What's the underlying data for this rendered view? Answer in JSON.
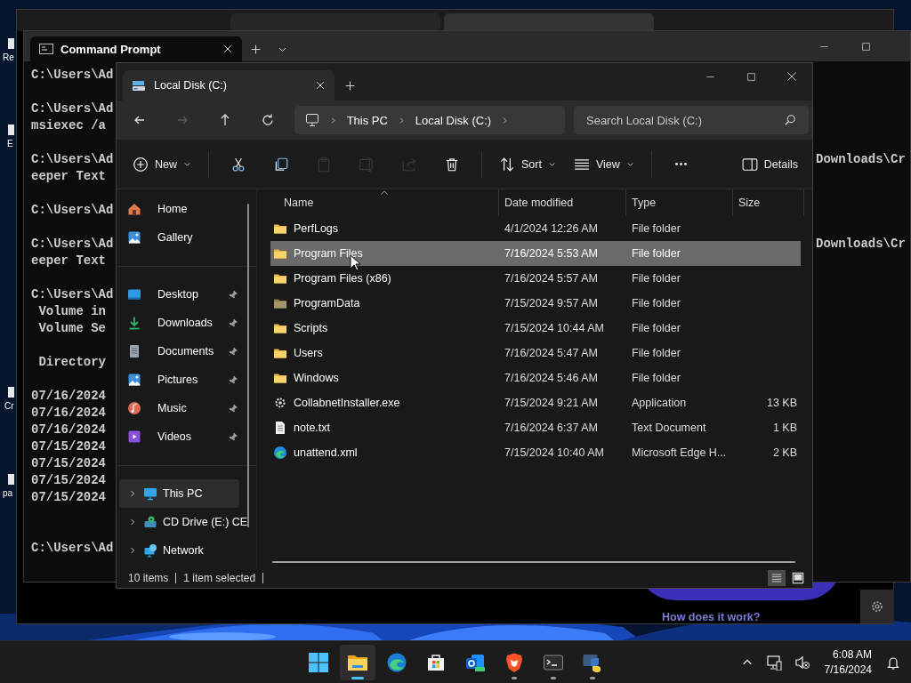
{
  "desktop_icons": [
    {
      "label": "Re"
    },
    {
      "label": "E"
    },
    {
      "label": "Cr"
    },
    {
      "label": "pa"
    }
  ],
  "browser": {
    "link": "How does it work?"
  },
  "cmd": {
    "tab_title": "Command Prompt",
    "blocks": [
      {
        "lines": [
          {
            "text": "C:\\Users\\Ad"
          }
        ]
      },
      {
        "lines": [
          {
            "text": "C:\\Users\\Ad"
          },
          {
            "text": "msiexec /a"
          }
        ]
      },
      {
        "lines": [
          {
            "text": "C:\\Users\\Ad",
            "right": "Downloads\\Cr"
          },
          {
            "text": "eeper Text"
          }
        ]
      },
      {
        "lines": [
          {
            "text": "C:\\Users\\Ad"
          }
        ]
      },
      {
        "lines": [
          {
            "text": "C:\\Users\\Ad",
            "right": "Downloads\\Cr"
          },
          {
            "text": "eeper Text"
          }
        ]
      },
      {
        "lines": [
          {
            "text": "C:\\Users\\Ad"
          },
          {
            "text": " Volume in"
          },
          {
            "text": " Volume Se"
          }
        ]
      },
      {
        "lines": [
          {
            "text": " Directory"
          }
        ]
      },
      {
        "lines": [
          {
            "text": "07/16/2024"
          },
          {
            "text": "07/16/2024"
          },
          {
            "text": "07/16/2024"
          },
          {
            "text": "07/15/2024"
          },
          {
            "text": "07/15/2024"
          },
          {
            "text": "07/15/2024"
          },
          {
            "text": "07/15/2024"
          }
        ]
      },
      {
        "lines": [
          {
            "text": "C:\\Users\\Ad"
          }
        ]
      }
    ]
  },
  "explorer": {
    "tab_title": "Local Disk (C:)",
    "nav": [
      {
        "kind": "back",
        "disabled": false
      },
      {
        "kind": "forward",
        "disabled": true
      },
      {
        "kind": "up",
        "disabled": false
      },
      {
        "kind": "refresh",
        "disabled": false
      }
    ],
    "breadcrumb": [
      "This PC",
      "Local Disk (C:)"
    ],
    "search": {
      "placeholder": "Search Local Disk (C:)"
    },
    "toolbar": [
      {
        "kind": "new",
        "label": "New",
        "disabled": false
      },
      {
        "kind": "cut",
        "disabled": false
      },
      {
        "kind": "copy",
        "disabled": false
      },
      {
        "kind": "paste",
        "disabled": true
      },
      {
        "kind": "rename",
        "disabled": true
      },
      {
        "kind": "share",
        "disabled": true
      },
      {
        "kind": "delete",
        "disabled": false
      },
      {
        "kind": "sort",
        "label": "Sort",
        "disabled": false
      },
      {
        "kind": "view",
        "label": "View",
        "disabled": false
      },
      {
        "kind": "more",
        "disabled": false
      }
    ],
    "details_button": "Details",
    "sidebar": [
      {
        "items": [
          {
            "kind": "home",
            "label": "Home",
            "pinned": false,
            "expandable": false,
            "selected": false
          },
          {
            "kind": "gallery",
            "label": "Gallery",
            "pinned": false,
            "expandable": false,
            "selected": false
          }
        ]
      },
      {
        "items": [
          {
            "kind": "desktop",
            "label": "Desktop",
            "pinned": true,
            "expandable": false,
            "selected": false
          },
          {
            "kind": "downloads",
            "label": "Downloads",
            "pinned": true,
            "expandable": false,
            "selected": false
          },
          {
            "kind": "documents",
            "label": "Documents",
            "pinned": true,
            "expandable": false,
            "selected": false
          },
          {
            "kind": "pictures",
            "label": "Pictures",
            "pinned": true,
            "expandable": false,
            "selected": false
          },
          {
            "kind": "music",
            "label": "Music",
            "pinned": true,
            "expandable": false,
            "selected": false
          },
          {
            "kind": "videos",
            "label": "Videos",
            "pinned": true,
            "expandable": false,
            "selected": false
          }
        ]
      },
      {
        "items": [
          {
            "kind": "pc",
            "label": "This PC",
            "pinned": false,
            "expandable": true,
            "selected": true
          },
          {
            "kind": "cd",
            "label": "CD Drive (E:) CE",
            "pinned": false,
            "expandable": true,
            "selected": false
          },
          {
            "kind": "network",
            "label": "Network",
            "pinned": false,
            "expandable": true,
            "selected": false
          }
        ]
      }
    ],
    "columns": [
      {
        "label": "Name",
        "sorted": true
      },
      {
        "label": "Date modified",
        "sorted": false
      },
      {
        "label": "Type",
        "sorted": false
      },
      {
        "label": "Size",
        "sorted": false
      }
    ],
    "rows": [
      {
        "kind": "folder",
        "name": "PerfLogs",
        "date": "4/1/2024 12:26 AM",
        "type": "File folder",
        "selected": false
      },
      {
        "kind": "folder",
        "name": "Program Files",
        "date": "7/16/2024 5:53 AM",
        "type": "File folder",
        "selected": true
      },
      {
        "kind": "folder",
        "name": "Program Files (x86)",
        "date": "7/16/2024 5:57 AM",
        "type": "File folder",
        "selected": false
      },
      {
        "kind": "hidden-folder",
        "name": "ProgramData",
        "date": "7/15/2024 9:57 AM",
        "type": "File folder",
        "selected": false
      },
      {
        "kind": "folder",
        "name": "Scripts",
        "date": "7/15/2024 10:44 AM",
        "type": "File folder",
        "selected": false
      },
      {
        "kind": "folder",
        "name": "Users",
        "date": "7/16/2024 5:47 AM",
        "type": "File folder",
        "selected": false
      },
      {
        "kind": "folder",
        "name": "Windows",
        "date": "7/16/2024 5:46 AM",
        "type": "File folder",
        "selected": false
      },
      {
        "kind": "application",
        "name": "CollabnetInstaller.exe",
        "date": "7/15/2024 9:21 AM",
        "type": "Application",
        "size": "13 KB",
        "selected": false
      },
      {
        "kind": "text",
        "name": "note.txt",
        "date": "7/16/2024 6:37 AM",
        "type": "Text Document",
        "size": "1 KB",
        "selected": false
      },
      {
        "kind": "web",
        "name": "unattend.xml",
        "date": "7/15/2024 10:40 AM",
        "type": "Microsoft Edge H...",
        "size": "2 KB",
        "selected": false
      }
    ],
    "status": {
      "count": "10 items",
      "selection": "1 item selected"
    },
    "view_modes": [
      {
        "kind": "details",
        "selected": true
      },
      {
        "kind": "tiles",
        "selected": false
      }
    ]
  },
  "taskbar": {
    "apps": [
      {
        "kind": "start",
        "running": false,
        "active": false
      },
      {
        "kind": "explorer",
        "running": true,
        "active": true
      },
      {
        "kind": "edge",
        "running": false,
        "active": false
      },
      {
        "kind": "store",
        "running": false,
        "active": false
      },
      {
        "kind": "mail",
        "running": false,
        "active": false
      },
      {
        "kind": "brave",
        "running": true,
        "active": false
      },
      {
        "kind": "terminal",
        "running": true,
        "active": false
      },
      {
        "kind": "python",
        "running": true,
        "active": false
      }
    ],
    "clock": {
      "time": "6:08 AM",
      "date": "7/16/2024"
    }
  }
}
